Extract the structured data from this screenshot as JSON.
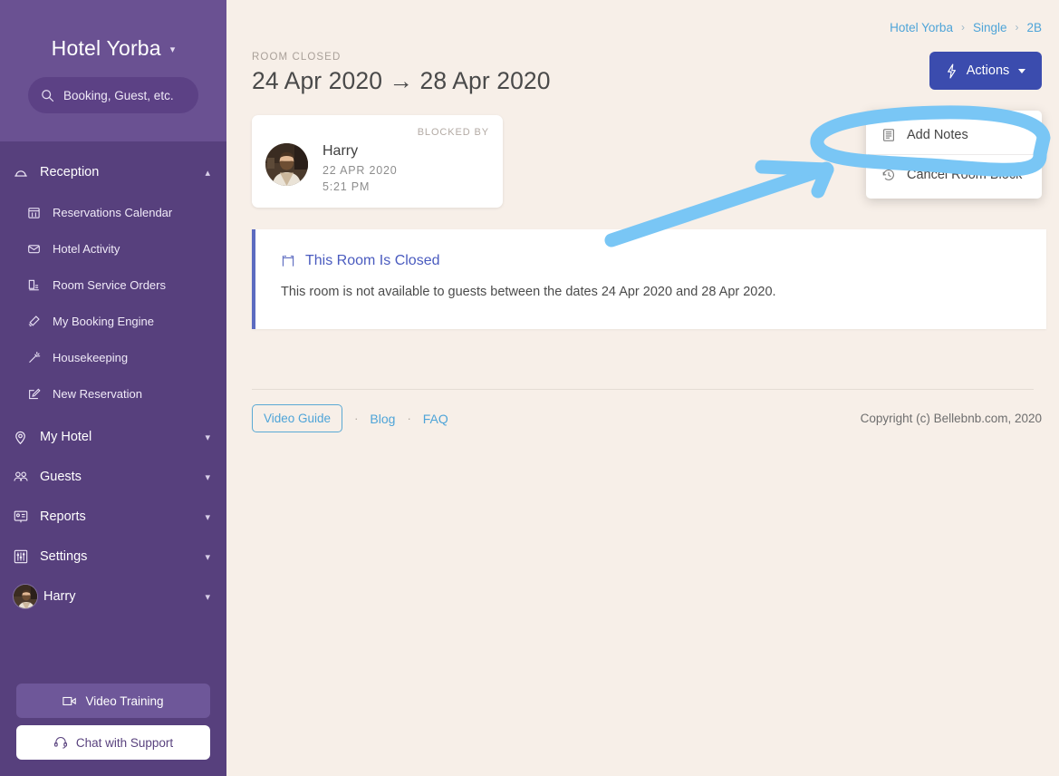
{
  "sidebar": {
    "brand": {
      "name": "Hotel Yorba",
      "caret_icon": "chevron-down-icon"
    },
    "search": {
      "placeholder": "Booking, Guest, etc.",
      "icon": "search-icon"
    },
    "reception": {
      "label": "Reception",
      "icon": "bell-concierge-icon",
      "caret_icon": "chevron-up-icon",
      "expanded": true,
      "items": [
        {
          "label": "Reservations Calendar",
          "icon": "calendar-icon"
        },
        {
          "label": "Hotel Activity",
          "icon": "envelope-icon"
        },
        {
          "label": "Room Service Orders",
          "icon": "room-service-icon"
        },
        {
          "label": "My Booking Engine",
          "icon": "booking-engine-icon"
        },
        {
          "label": "Housekeeping",
          "icon": "magic-wand-icon"
        },
        {
          "label": "New Reservation",
          "icon": "pencil-square-icon"
        }
      ]
    },
    "groups": [
      {
        "label": "My Hotel",
        "icon": "map-pin-icon",
        "caret_icon": "chevron-down-icon"
      },
      {
        "label": "Guests",
        "icon": "guests-icon",
        "caret_icon": "chevron-down-icon"
      },
      {
        "label": "Reports",
        "icon": "reports-icon",
        "caret_icon": "chevron-down-icon"
      },
      {
        "label": "Settings",
        "icon": "sliders-icon",
        "caret_icon": "chevron-down-icon"
      }
    ],
    "user": {
      "label": "Harry",
      "avatar_icon": "avatar",
      "caret_icon": "chevron-down-icon"
    },
    "video_training": {
      "label": "Video Training",
      "icon": "video-camera-icon"
    },
    "chat_support": {
      "label": "Chat with Support",
      "icon": "headset-icon"
    }
  },
  "breadcrumb": {
    "items": [
      "Hotel Yorba",
      "Single",
      "2B"
    ],
    "separator": "›"
  },
  "page": {
    "eyebrow": "ROOM CLOSED",
    "title": "24 Apr 2020 → 28 Apr 2020"
  },
  "actions": {
    "label": "Actions",
    "icon": "bolt-icon",
    "caret_icon": "caret-down-icon",
    "menu": [
      {
        "label": "Add Notes",
        "icon": "notes-icon"
      },
      {
        "label": "Cancel Room Block",
        "icon": "history-clock-icon"
      }
    ]
  },
  "blocked_card": {
    "label": "BLOCKED BY",
    "name": "Harry",
    "date": "22 APR 2020",
    "time": "5:21 PM"
  },
  "alert": {
    "icon": "closed-flag-icon",
    "title": "This Room Is Closed",
    "body": "This room is not available to guests between the dates 24 Apr 2020 and 28 Apr 2020."
  },
  "footer": {
    "video_guide": "Video Guide",
    "dot": "·",
    "links": [
      "Blog",
      "FAQ"
    ],
    "copyright": "Copyright (c) Bellebnb.com, 2020"
  },
  "annotation": {
    "type": "hand-drawn-highlight",
    "color": "#7cc7f2",
    "shapes": [
      "ellipse-around-add-notes",
      "arrow-pointing-to-add-notes"
    ]
  },
  "colors": {
    "sidebar_top": "#6a5192",
    "sidebar": "#57407d",
    "background": "#f7efe8",
    "accent_blue": "#3b4cae",
    "link_blue": "#4ea4d8",
    "alert_border": "#5c6bc0",
    "annotation": "#7cc7f2"
  }
}
